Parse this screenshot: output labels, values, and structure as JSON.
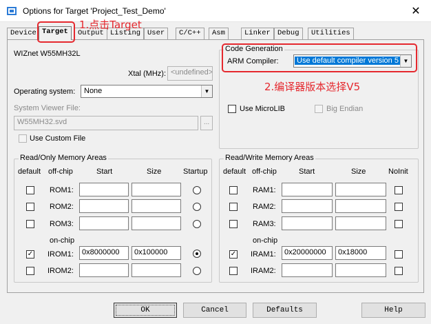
{
  "window": {
    "title": "Options for Target 'Project_Test_Demo'",
    "close_glyph": "✕"
  },
  "tabs": [
    {
      "label": "Device"
    },
    {
      "label": "Target"
    },
    {
      "label": "Output"
    },
    {
      "label": "Listing"
    },
    {
      "label": "User"
    },
    {
      "label": "C/C++"
    },
    {
      "label": "Asm"
    },
    {
      "label": "Linker"
    },
    {
      "label": "Debug"
    },
    {
      "label": "Utilities"
    }
  ],
  "active_tab": "Target",
  "target": {
    "device_name": "WIZnet W55MH32L",
    "xtal_label": "Xtal (MHz):",
    "xtal_value": "<undefined>",
    "os_label": "Operating system:",
    "os_value": "None",
    "svd_label": "System Viewer File:",
    "svd_value": "W55MH32.svd",
    "browse_label": "...",
    "custom_file_label": "Use Custom File"
  },
  "code_generation": {
    "legend": "Code Generation",
    "compiler_label": "ARM Compiler:",
    "compiler_value": "Use default compiler version 5",
    "microlib_label": "Use MicroLIB",
    "big_endian_label": "Big Endian"
  },
  "ro_memory": {
    "legend": "Read/Only Memory Areas",
    "headers": {
      "default": "default",
      "offchip": "off-chip",
      "start": "Start",
      "size": "Size",
      "last": "Startup"
    },
    "onchip_label": "on-chip",
    "rows": [
      {
        "name": "ROM1:",
        "start": "",
        "size": ""
      },
      {
        "name": "ROM2:",
        "start": "",
        "size": ""
      },
      {
        "name": "ROM3:",
        "start": "",
        "size": ""
      },
      {
        "name": "IROM1:",
        "start": "0x8000000",
        "size": "0x100000"
      },
      {
        "name": "IROM2:",
        "start": "",
        "size": ""
      }
    ]
  },
  "rw_memory": {
    "legend": "Read/Write Memory Areas",
    "headers": {
      "default": "default",
      "offchip": "off-chip",
      "start": "Start",
      "size": "Size",
      "last": "NoInit"
    },
    "onchip_label": "on-chip",
    "rows": [
      {
        "name": "RAM1:",
        "start": "",
        "size": ""
      },
      {
        "name": "RAM2:",
        "start": "",
        "size": ""
      },
      {
        "name": "RAM3:",
        "start": "",
        "size": ""
      },
      {
        "name": "IRAM1:",
        "start": "0x20000000",
        "size": "0x18000"
      },
      {
        "name": "IRAM2:",
        "start": "",
        "size": ""
      }
    ]
  },
  "buttons": {
    "ok": "OK",
    "cancel": "Cancel",
    "defaults": "Defaults",
    "help": "Help"
  },
  "annotations": {
    "step1": "1.点击Target",
    "step2": "2.编译器版本选择V5"
  },
  "colors": {
    "annotation": "#e5282e",
    "selection": "#0078d7"
  }
}
